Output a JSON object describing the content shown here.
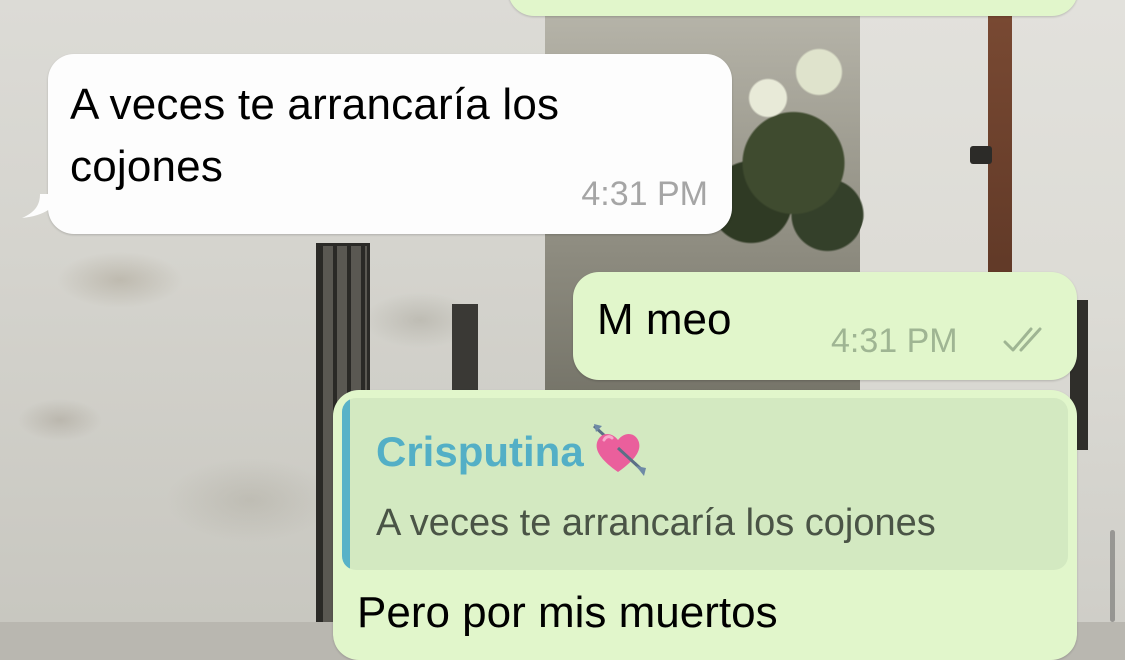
{
  "messages": [
    {
      "direction": "incoming",
      "text": "A veces te arrancaría los cojones",
      "time": "4:31 PM"
    },
    {
      "direction": "outgoing",
      "text": "M meo",
      "time": "4:31 PM",
      "status_icon": "double-check-icon"
    },
    {
      "direction": "outgoing",
      "quote": {
        "author": "Crisputina",
        "author_emoji_icon": "heart-with-arrow-icon",
        "text": "A veces te arrancaría los cojones"
      },
      "text": "Pero por mis muertos"
    }
  ],
  "colors": {
    "incoming_bubble": "#fdfdfd",
    "outgoing_bubble": "#e1f6cb",
    "quote_background": "#d3e9c1",
    "quote_accent": "#58b2c8",
    "timestamp_incoming": "#a5a5a5",
    "timestamp_outgoing": "#9fb593"
  }
}
